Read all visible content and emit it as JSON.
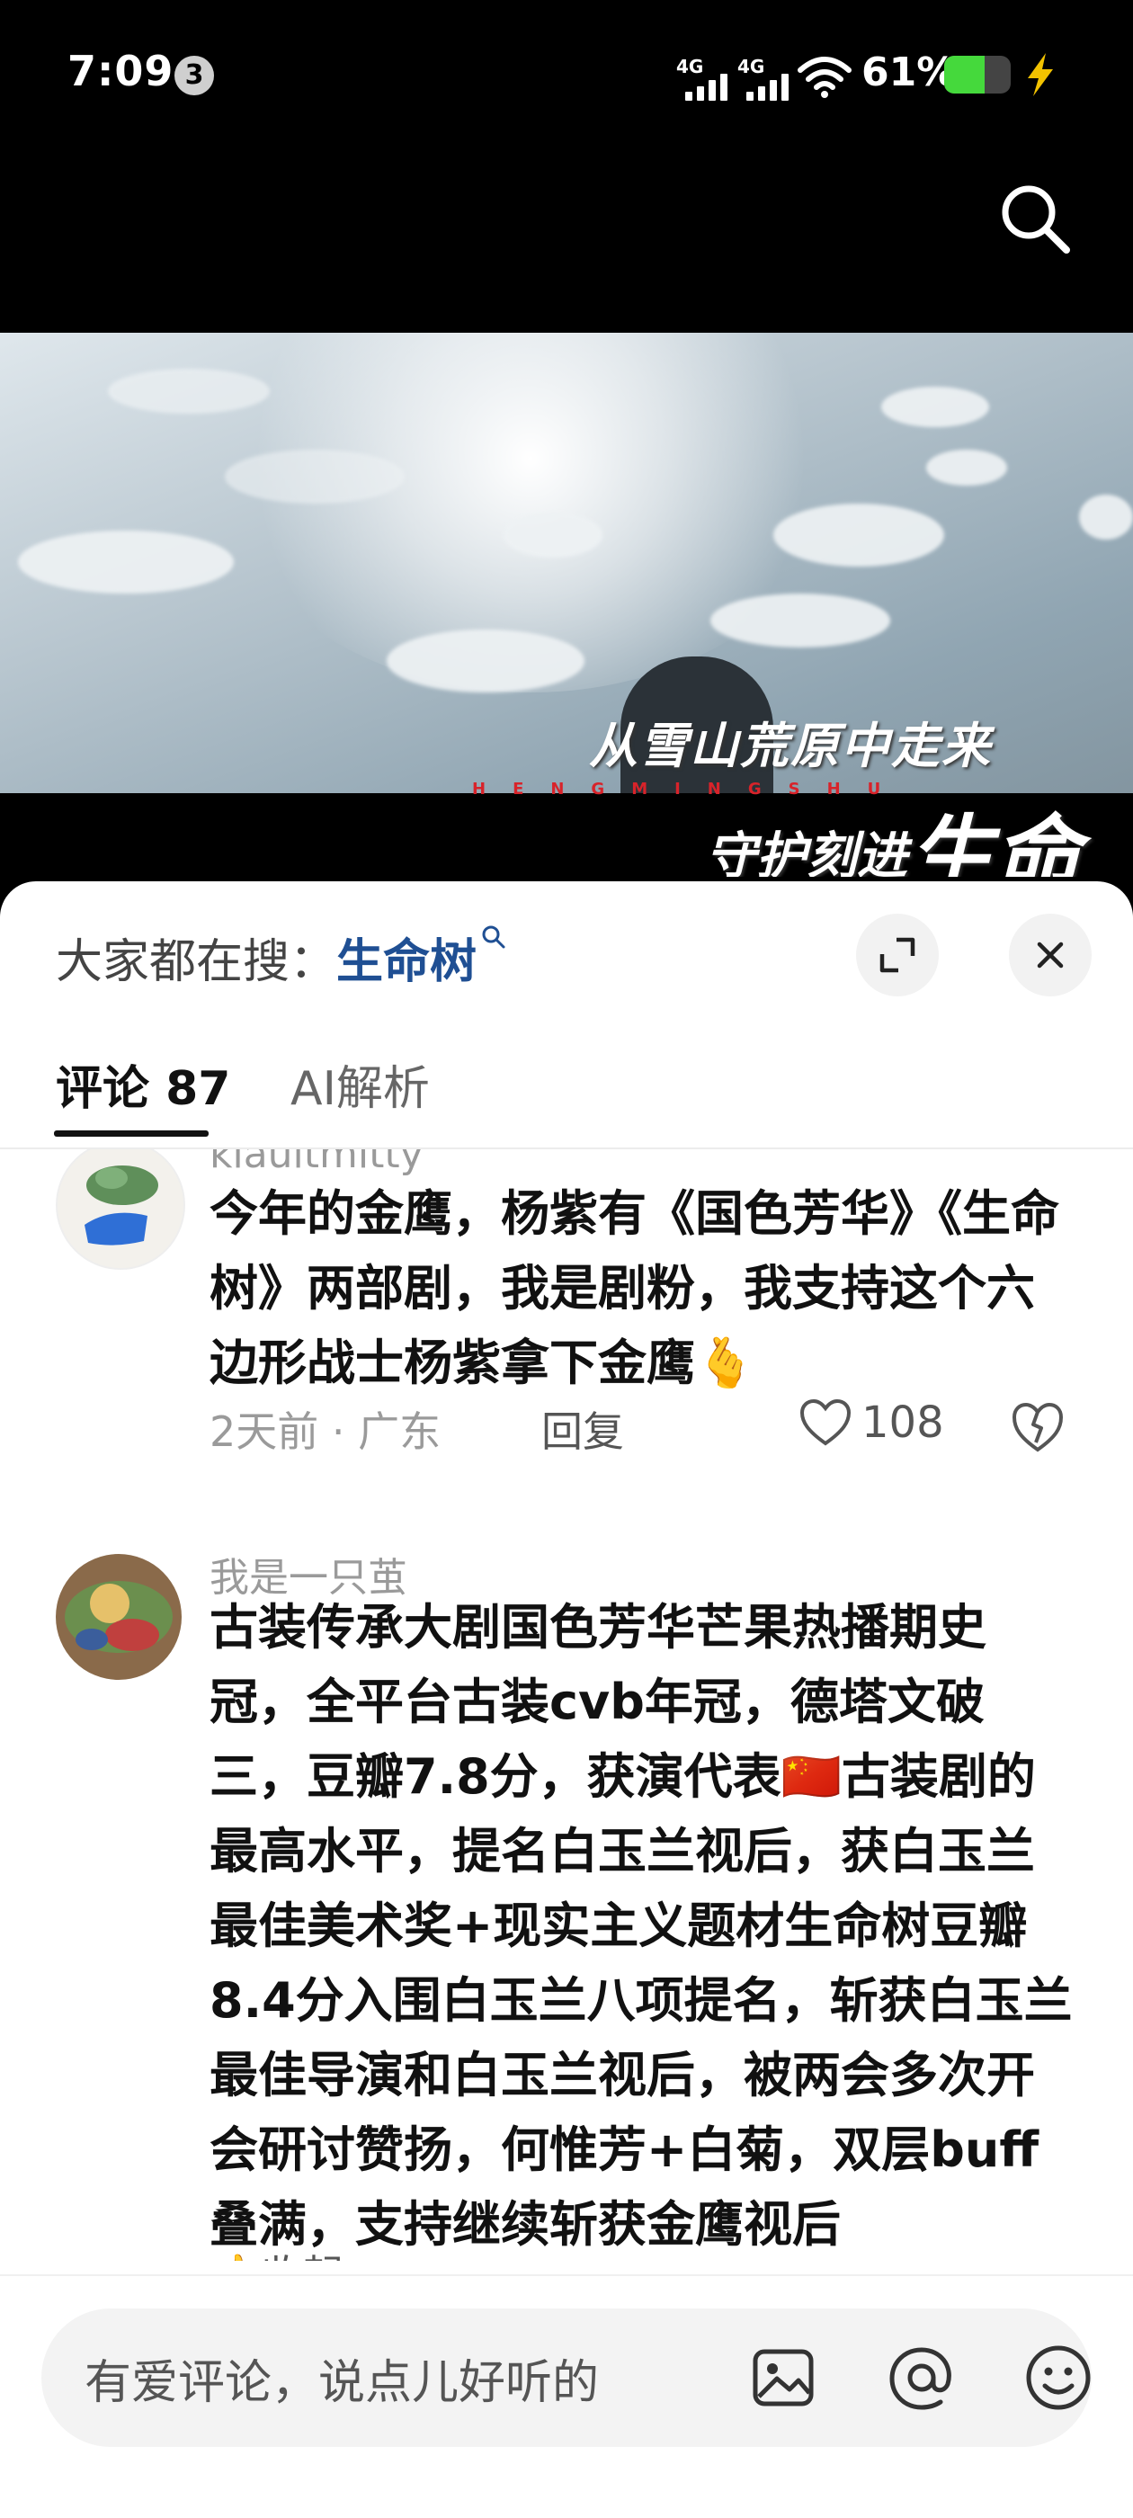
{
  "status_bar": {
    "time": "7:09",
    "notification_count": "3",
    "signal1_label": "4G",
    "signal2_label": "4G",
    "battery_text": "61%",
    "battery_level": 0.61
  },
  "video": {
    "caption_line1": "从雪山荒原中走来",
    "caption_red": "HENGMINGSHU",
    "caption_line2_a": "守护刻进",
    "caption_line2_b": "生命"
  },
  "trending": {
    "label": "大家都在搜：",
    "query": "生命树"
  },
  "tabs": [
    {
      "label": "评论 87",
      "active": true
    },
    {
      "label": "AI解析",
      "active": false
    }
  ],
  "comments": [
    {
      "user": "kiauitmitty",
      "text": "今年的金鹰，杨紫有《国色芳华》《生命树》两部剧，我是剧粉，我支持这个六边形战士杨紫拿下金鹰🫰",
      "time": "2天前",
      "location": "广东",
      "reply_label": "回复",
      "likes": "108"
    },
    {
      "user": "我是一只茧",
      "text": "古装传承大剧国色芳华芒果热播期史冠，全平台古装cvb年冠，德塔文破三，豆瓣7.8分，获演代表🇨🇳古装剧的最高水平，提名白玉兰视后，获白玉兰最佳美术奖+现实主义题材生命树豆瓣8.4分入围白玉兰八项提名，斩获白玉兰最佳导演和白玉兰视后，被两会多次开会研讨赞扬，何惟芳+白菊，双层buff叠满，支持继续斩获金鹰视后",
      "extra": "👍收起"
    }
  ],
  "input": {
    "placeholder": "有爱评论，说点儿好听的"
  },
  "colors": {
    "accent_link": "#1f4f93",
    "battery_green": "#45d93c"
  }
}
